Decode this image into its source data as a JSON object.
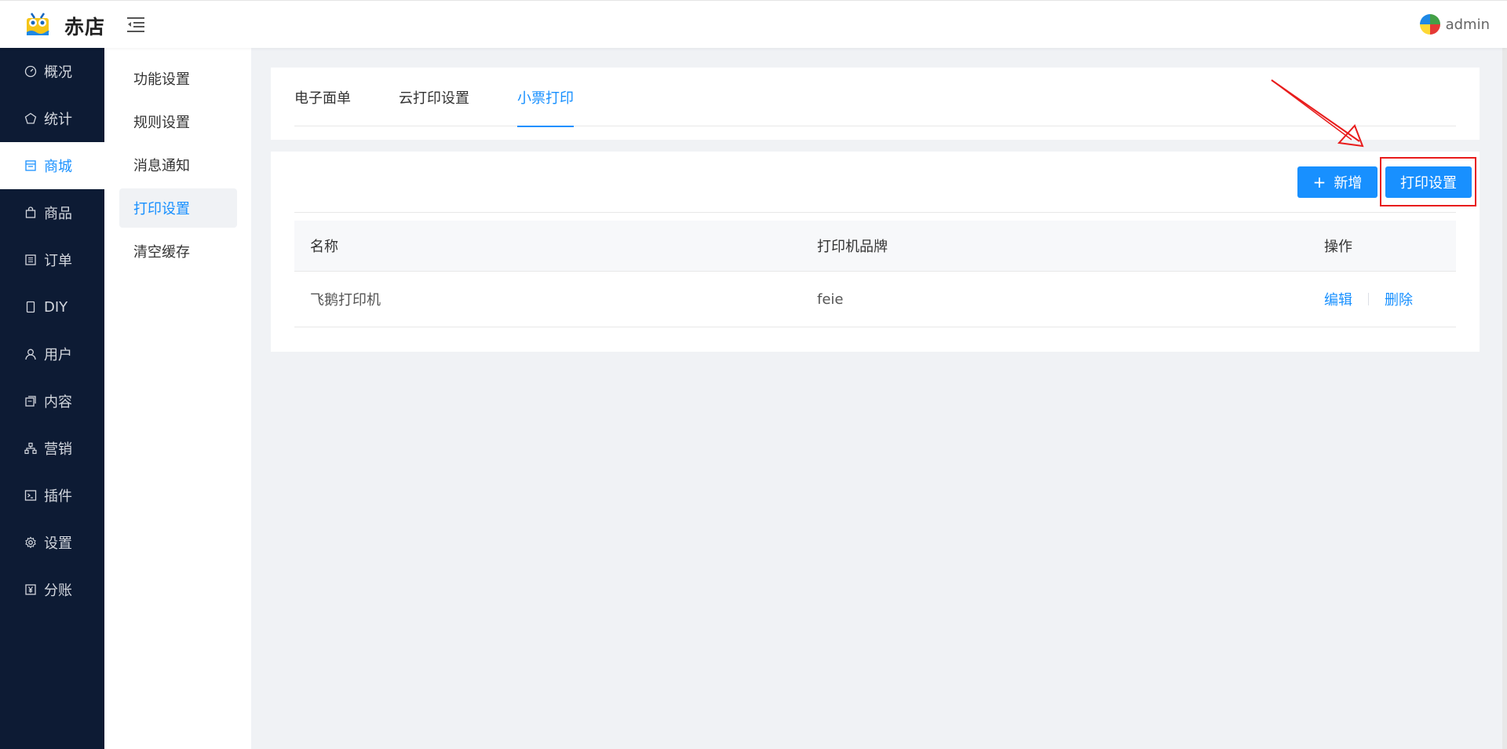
{
  "header": {
    "brand": "赤店",
    "user_name": "admin"
  },
  "sidebar": {
    "items": [
      {
        "label": "概况",
        "icon": "dashboard-icon"
      },
      {
        "label": "统计",
        "icon": "pentagon-icon"
      },
      {
        "label": "商城",
        "icon": "shop-icon",
        "active": true
      },
      {
        "label": "商品",
        "icon": "bag-icon"
      },
      {
        "label": "订单",
        "icon": "order-list-icon"
      },
      {
        "label": "DIY",
        "icon": "phone-icon"
      },
      {
        "label": "用户",
        "icon": "user-icon"
      },
      {
        "label": "内容",
        "icon": "content-icon"
      },
      {
        "label": "营销",
        "icon": "org-chart-icon"
      },
      {
        "label": "插件",
        "icon": "terminal-icon"
      },
      {
        "label": "设置",
        "icon": "gear-icon"
      },
      {
        "label": "分账",
        "icon": "yen-icon"
      }
    ]
  },
  "subnav": {
    "items": [
      "功能设置",
      "规则设置",
      "消息通知",
      "打印设置",
      "清空缓存"
    ],
    "active_index": 3
  },
  "tabs": {
    "items": [
      "电子面单",
      "云打印设置",
      "小票打印"
    ],
    "active_index": 2
  },
  "toolbar": {
    "add_label": "新增",
    "print_settings_label": "打印设置"
  },
  "table": {
    "headers": [
      "名称",
      "打印机品牌",
      "操作"
    ],
    "rows": [
      {
        "name": "飞鹅打印机",
        "brand": "feie",
        "edit": "编辑",
        "delete": "删除"
      }
    ]
  },
  "colors": {
    "accent": "#1890ff",
    "sidebar_bg": "#0d1b34",
    "annotation": "#e81c1c"
  }
}
